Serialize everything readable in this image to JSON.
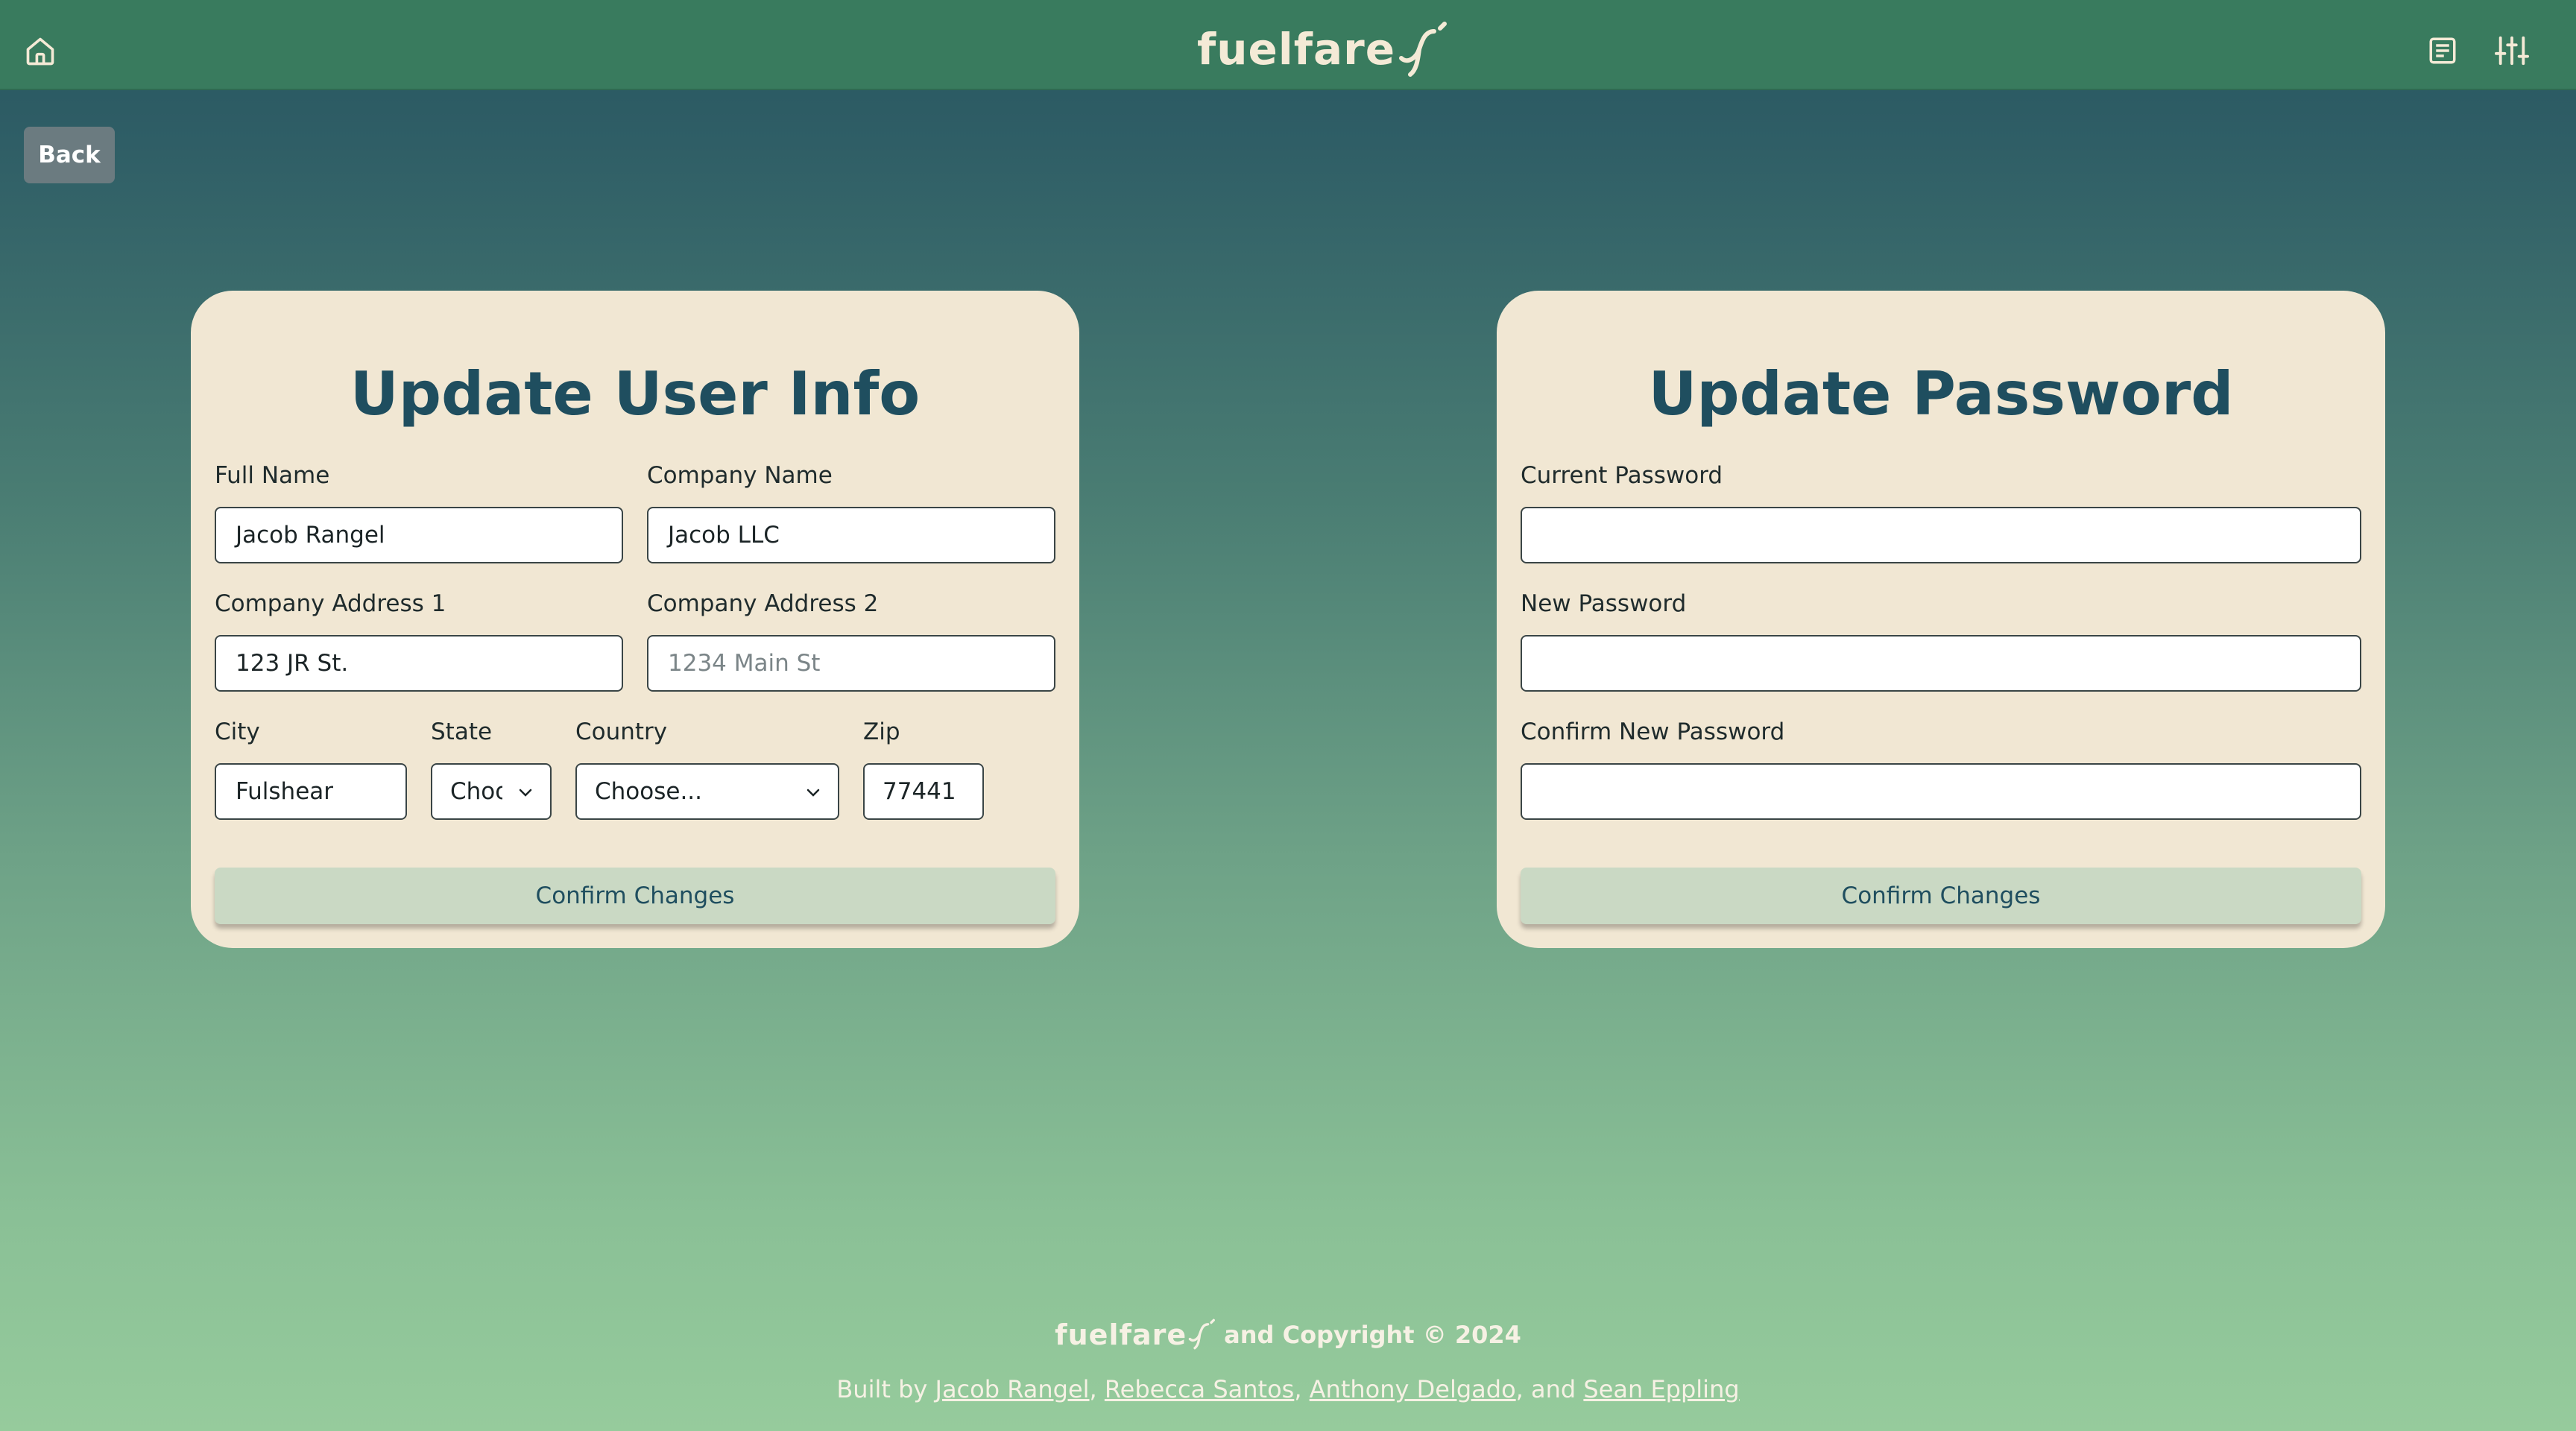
{
  "header": {
    "logo_text": "fuelfare",
    "home_icon": "home-icon",
    "list_icon": "document-list-icon",
    "settings_icon": "sliders-icon",
    "background_color": "#397b5e"
  },
  "back_button": {
    "label": "Back"
  },
  "user_info_card": {
    "title": "Update User Info",
    "full_name": {
      "label": "Full Name",
      "value": "Jacob Rangel"
    },
    "company_name": {
      "label": "Company Name",
      "value": "Jacob LLC"
    },
    "company_address_1": {
      "label": "Company Address 1",
      "value": "123 JR St."
    },
    "company_address_2": {
      "label": "Company Address 2",
      "placeholder": "1234 Main St"
    },
    "city": {
      "label": "City",
      "value": "Fulshear"
    },
    "state": {
      "label": "State",
      "selected": "Choose..."
    },
    "country": {
      "label": "Country",
      "selected": "Choose..."
    },
    "zip": {
      "label": "Zip",
      "value": "77441"
    },
    "confirm_label": "Confirm Changes"
  },
  "password_card": {
    "title": "Update Password",
    "current_password": {
      "label": "Current Password",
      "value": ""
    },
    "new_password": {
      "label": "New Password",
      "value": ""
    },
    "confirm_new_password": {
      "label": "Confirm New Password",
      "value": ""
    },
    "confirm_label": "Confirm Changes"
  },
  "footer": {
    "logo_text": "fuelfare",
    "copyright": "and Copyright © 2024",
    "built_by_prefix": "Built by ",
    "authors": [
      "Jacob Rangel",
      "Rebecca Santos",
      "Anthony Delgado",
      "Sean Eppling"
    ],
    "sep1": ", ",
    "sep2": ", ",
    "sep3": ", and "
  },
  "colors": {
    "card_background": "#f1e7d3",
    "title_color": "#1f4e5f",
    "confirm_button": "#cad9c4",
    "back_button": "#6b7b80"
  }
}
